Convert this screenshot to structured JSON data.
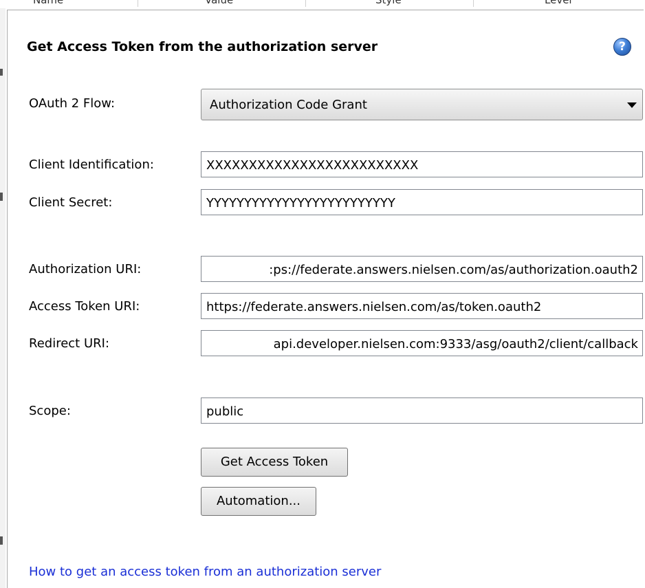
{
  "background_table": {
    "header_fragments": [
      "Name",
      "Value",
      "Style",
      "Level"
    ]
  },
  "dialog": {
    "title": "Get Access Token from the authorization server",
    "help_icon": "help-question-icon",
    "oauth_flow": {
      "label": "OAuth 2 Flow:",
      "selected": "Authorization Code Grant"
    },
    "client_identification": {
      "label": "Client Identification:",
      "value": "XXXXXXXXXXXXXXXXXXXXXXXXX"
    },
    "client_secret": {
      "label": "Client Secret:",
      "value": "YYYYYYYYYYYYYYYYYYYYYYYYY"
    },
    "authorization_uri": {
      "label": "Authorization URI:",
      "value": ":ps://federate.answers.nielsen.com/as/authorization.oauth2"
    },
    "access_token_uri": {
      "label": "Access Token URI:",
      "value": "https://federate.answers.nielsen.com/as/token.oauth2"
    },
    "redirect_uri": {
      "label": "Redirect URI:",
      "value": "api.developer.nielsen.com:9333/asg/oauth2/client/callback"
    },
    "scope": {
      "label": "Scope:",
      "value": "public"
    },
    "get_access_token_button": "Get Access Token",
    "automation_button": "Automation...",
    "help_link": "How to get an access token from an authorization server"
  },
  "colors": {
    "link": "#1a2fd6",
    "help_icon": "#3f7fd6"
  }
}
